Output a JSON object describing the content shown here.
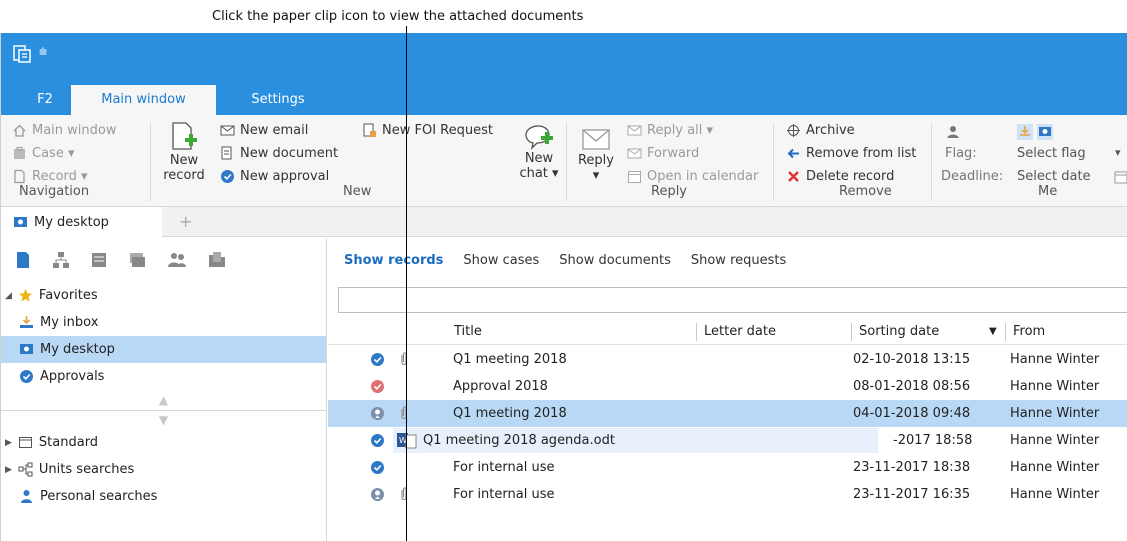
{
  "annotation": "Click the paper clip icon to view the attached documents",
  "quick_access": {
    "dropdown_glyph": "⩧"
  },
  "tabs": [
    {
      "label": "F2",
      "active": false
    },
    {
      "label": "Main window",
      "active": true
    },
    {
      "label": "Settings",
      "active": false
    }
  ],
  "ribbon": {
    "navigation": {
      "group_label": "Navigation",
      "main_window": "Main window",
      "case": "Case ▾",
      "record": "Record ▾"
    },
    "new": {
      "group_label": "New",
      "new_record_line1": "New",
      "new_record_line2": "record",
      "new_email": "New email",
      "new_document": "New document",
      "new_approval": "New approval",
      "new_foi_request": "New FOI Request",
      "new_chat_line1": "New",
      "new_chat_line2": "chat ▾"
    },
    "reply": {
      "group_label": "Reply",
      "reply_line1": "Reply",
      "reply_line2": "▾",
      "reply_all": "Reply all ▾",
      "forward": "Forward",
      "open_in_calendar": "Open in calendar"
    },
    "remove": {
      "group_label": "Remove",
      "archive": "Archive",
      "remove_from_list": "Remove from list",
      "delete_record": "Delete record"
    },
    "me": {
      "group_label": "Me",
      "flag_label": "Flag:",
      "flag_value": "Select flag",
      "deadline_label": "Deadline:",
      "deadline_value": "Select date",
      "more_glyph": "▾"
    }
  },
  "desktop_tab": {
    "label": "My desktop",
    "plus": "+"
  },
  "sidebar": {
    "favorites_label": "Favorites",
    "favorites_items": [
      {
        "label": "My inbox",
        "icon": "inbox-icon",
        "selected": false
      },
      {
        "label": "My desktop",
        "icon": "desktop-icon",
        "selected": true
      },
      {
        "label": "Approvals",
        "icon": "check-circle-icon",
        "selected": false
      }
    ],
    "sections": [
      {
        "label": "Standard",
        "icon": "folder-icon"
      },
      {
        "label": "Units searches",
        "icon": "org-icon"
      },
      {
        "label": "Personal searches",
        "icon": "person-icon"
      }
    ]
  },
  "show_tabs": [
    {
      "label": "Show records",
      "active": true
    },
    {
      "label": "Show cases",
      "active": false
    },
    {
      "label": "Show documents",
      "active": false
    },
    {
      "label": "Show requests",
      "active": false
    }
  ],
  "columns": {
    "title": "Title",
    "letter_date": "Letter date",
    "sorting_date": "Sorting date",
    "sort_glyph": "▼",
    "from": "From"
  },
  "records": [
    {
      "status": "approved",
      "clip": true,
      "title": "Q1 meeting 2018",
      "sorting_date": "02-10-2018 13:15",
      "from": "Hanne Winter",
      "selected": false
    },
    {
      "status": "rejected",
      "clip": false,
      "title": "Approval 2018",
      "sorting_date": "08-01-2018 08:56",
      "from": "Hanne Winter",
      "selected": false
    },
    {
      "status": "pending",
      "clip": true,
      "title": "Q1 meeting 2018",
      "sorting_date": "04-01-2018 09:48",
      "from": "Hanne Winter",
      "selected": true
    },
    {
      "status": "approved",
      "clip": false,
      "title": "",
      "sorting_date": "-2017 18:58",
      "from": "Hanne Winter",
      "selected": false,
      "drag_attachment": "Q1 meeting 2018 agenda.odt"
    },
    {
      "status": "approved",
      "clip": false,
      "title": "For internal use",
      "sorting_date": "23-11-2017 18:38",
      "from": "Hanne Winter",
      "selected": false
    },
    {
      "status": "pending",
      "clip": true,
      "title": "For internal use",
      "sorting_date": "23-11-2017 16:35",
      "from": "Hanne Winter",
      "selected": false
    }
  ]
}
